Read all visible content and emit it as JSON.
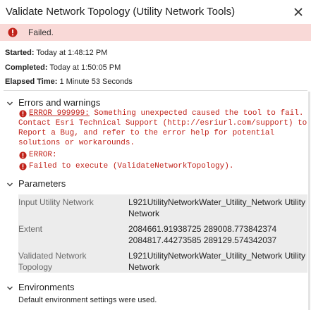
{
  "window": {
    "title": "Validate Network Topology (Utility Network Tools)"
  },
  "banner": {
    "status": "Failed."
  },
  "info": {
    "started_label": "Started:",
    "started_value": "Today at 1:48:12 PM",
    "completed_label": "Completed:",
    "completed_value": "Today at 1:50:05 PM",
    "elapsed_label": "Elapsed Time:",
    "elapsed_value": "1 Minute 53 Seconds"
  },
  "errors": {
    "heading": "Errors and warnings",
    "msg1_code": "ERROR 999999:",
    "msg1_line1": " Something unexpected caused the tool to fail.",
    "msg1_line2": "Contact Esri Technical Support (http://esriurl.com/support) to",
    "msg1_line3": "Report a Bug, and refer to the error help for potential",
    "msg1_line4": "solutions or workarounds.",
    "msg2_line1": "ERROR:",
    "msg3_line1": "Failed to execute (ValidateNetworkTopology)."
  },
  "parameters": {
    "heading": "Parameters",
    "rows": [
      {
        "name_l1": "Input Utility Network",
        "name_l2": "",
        "value_l1": "L921UtilityNetworkWater_Utility_Network Utility",
        "value_l2": "Network"
      },
      {
        "name_l1": "Extent",
        "name_l2": "",
        "value_l1": "2084661.91938725 289008.773842374",
        "value_l2": "2084817.44273585 289129.574342037"
      },
      {
        "name_l1": "Validated Network",
        "name_l2": "Topology",
        "value_l1": "L921UtilityNetworkWater_Utility_Network Utility",
        "value_l2": "Network"
      }
    ]
  },
  "environments": {
    "heading": "Environments",
    "text": "Default environment settings were used."
  },
  "colors": {
    "error": "#c0221a",
    "banner_bg": "#f9d9d7",
    "param_bg": "#ececec"
  },
  "icons": {
    "close": "close-icon",
    "error": "error-icon",
    "chevron": "chevron-down-icon"
  }
}
